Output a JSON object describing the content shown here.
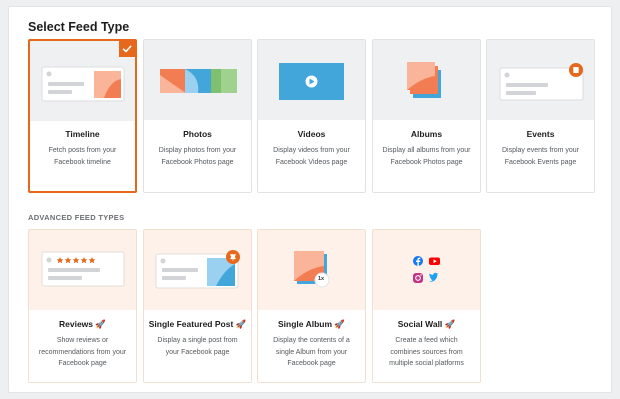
{
  "heading": "Select Feed Type",
  "advanced_heading": "ADVANCED FEED TYPES",
  "accent_color": "#e5681c",
  "feed_types": [
    {
      "key": "timeline",
      "title": "Timeline",
      "description": "Fetch posts from your Facebook timeline",
      "selected": true,
      "icon": "timeline-illustration"
    },
    {
      "key": "photos",
      "title": "Photos",
      "description": "Display photos from your Facebook Photos page",
      "icon": "photos-illustration"
    },
    {
      "key": "videos",
      "title": "Videos",
      "description": "Display videos from your Facebook Videos page",
      "icon": "video-illustration"
    },
    {
      "key": "albums",
      "title": "Albums",
      "description": "Display all albums from your Facebook Photos page",
      "icon": "albums-illustration"
    },
    {
      "key": "events",
      "title": "Events",
      "description": "Display events from your Facebook Events page",
      "icon": "events-illustration"
    }
  ],
  "advanced_feed_types": [
    {
      "key": "reviews",
      "title": "Reviews",
      "description": "Show reviews or recommendations from your Facebook page",
      "icon": "reviews-illustration",
      "pro_badge": "rocket-icon"
    },
    {
      "key": "single-featured-post",
      "title": "Single Featured Post",
      "description": "Display a single post from your Facebook page",
      "icon": "featured-post-illustration",
      "pro_badge": "rocket-icon"
    },
    {
      "key": "single-album",
      "title": "Single Album",
      "description": "Display the contents of a single Album from your Facebook page",
      "icon": "single-album-illustration",
      "pro_badge": "rocket-icon",
      "album_count_badge": "1x"
    },
    {
      "key": "social-wall",
      "title": "Social Wall",
      "description": "Create a feed which combines sources from multiple social platforms",
      "icon": "social-wall-illustration",
      "pro_badge": "rocket-icon"
    }
  ]
}
